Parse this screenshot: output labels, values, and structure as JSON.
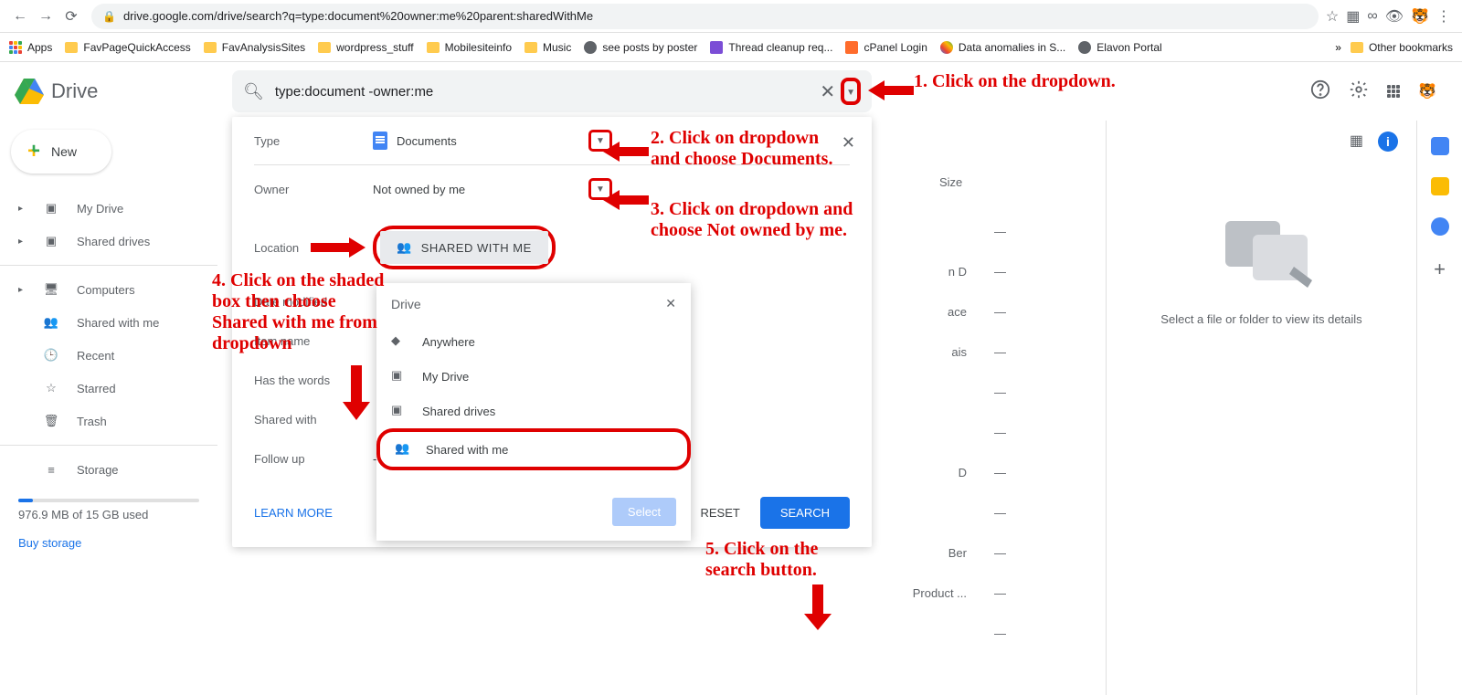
{
  "browser": {
    "url": "drive.google.com/drive/search?q=type:document%20owner:me%20parent:sharedWithMe"
  },
  "bookmarks": {
    "apps": "Apps",
    "items": [
      "FavPageQuickAccess",
      "FavAnalysisSites",
      "wordpress_stuff",
      "Mobilesiteinfo",
      "Music",
      "see posts by poster",
      "Thread cleanup req...",
      "cPanel Login",
      "Data anomalies in S...",
      "Elavon Portal"
    ],
    "other": "Other bookmarks"
  },
  "drive": {
    "name": "Drive",
    "search_value": "type:document -owner:me",
    "new_btn": "New"
  },
  "sidebar": {
    "my_drive": "My Drive",
    "shared_drives": "Shared drives",
    "computers": "Computers",
    "shared_with_me": "Shared with me",
    "recent": "Recent",
    "starred": "Starred",
    "trash": "Trash",
    "storage": "Storage",
    "storage_used": "976.9 MB of 15 GB used",
    "buy": "Buy storage"
  },
  "results": {
    "size_hdr": "Size",
    "rows": [
      {
        "name": "",
        "size": "—"
      },
      {
        "name": "n D",
        "size": "—"
      },
      {
        "name": "ace",
        "size": "—"
      },
      {
        "name": "ais",
        "size": "—"
      },
      {
        "name": "",
        "size": "—"
      },
      {
        "name": "",
        "size": "—"
      },
      {
        "name": "D",
        "size": "—"
      },
      {
        "name": "",
        "size": "—"
      },
      {
        "name": "Ber",
        "size": "—"
      },
      {
        "name": "Product ...",
        "size": "—"
      },
      {
        "name": "",
        "size": "—"
      }
    ]
  },
  "details": {
    "message": "Select a file or folder to view its details"
  },
  "popup": {
    "type_lbl": "Type",
    "type_val": "Documents",
    "owner_lbl": "Owner",
    "owner_val": "Not owned by me",
    "location_lbl": "Location",
    "location_val": "SHARED WITH ME",
    "date_lbl": "Date modified",
    "item_lbl": "Item name",
    "words_lbl": "Has the words",
    "shared_lbl": "Shared with",
    "follow_lbl": "Follow up",
    "learn_more": "LEARN MORE",
    "reset": "RESET",
    "search": "SEARCH"
  },
  "loc_dd": {
    "title": "Drive",
    "anywhere": "Anywhere",
    "my_drive": "My Drive",
    "shared_drives": "Shared drives",
    "shared_with_me": "Shared with me",
    "select": "Select"
  },
  "annotations": {
    "a1": "1.  Click on the dropdown.",
    "a2": "2. Click on dropdown and choose Documents.",
    "a3": "3. Click on dropdown and choose Not owned by me.",
    "a4": "4. Click on the shaded box then choose Shared with me from dropdown",
    "a5": "5. Click on the search button."
  }
}
